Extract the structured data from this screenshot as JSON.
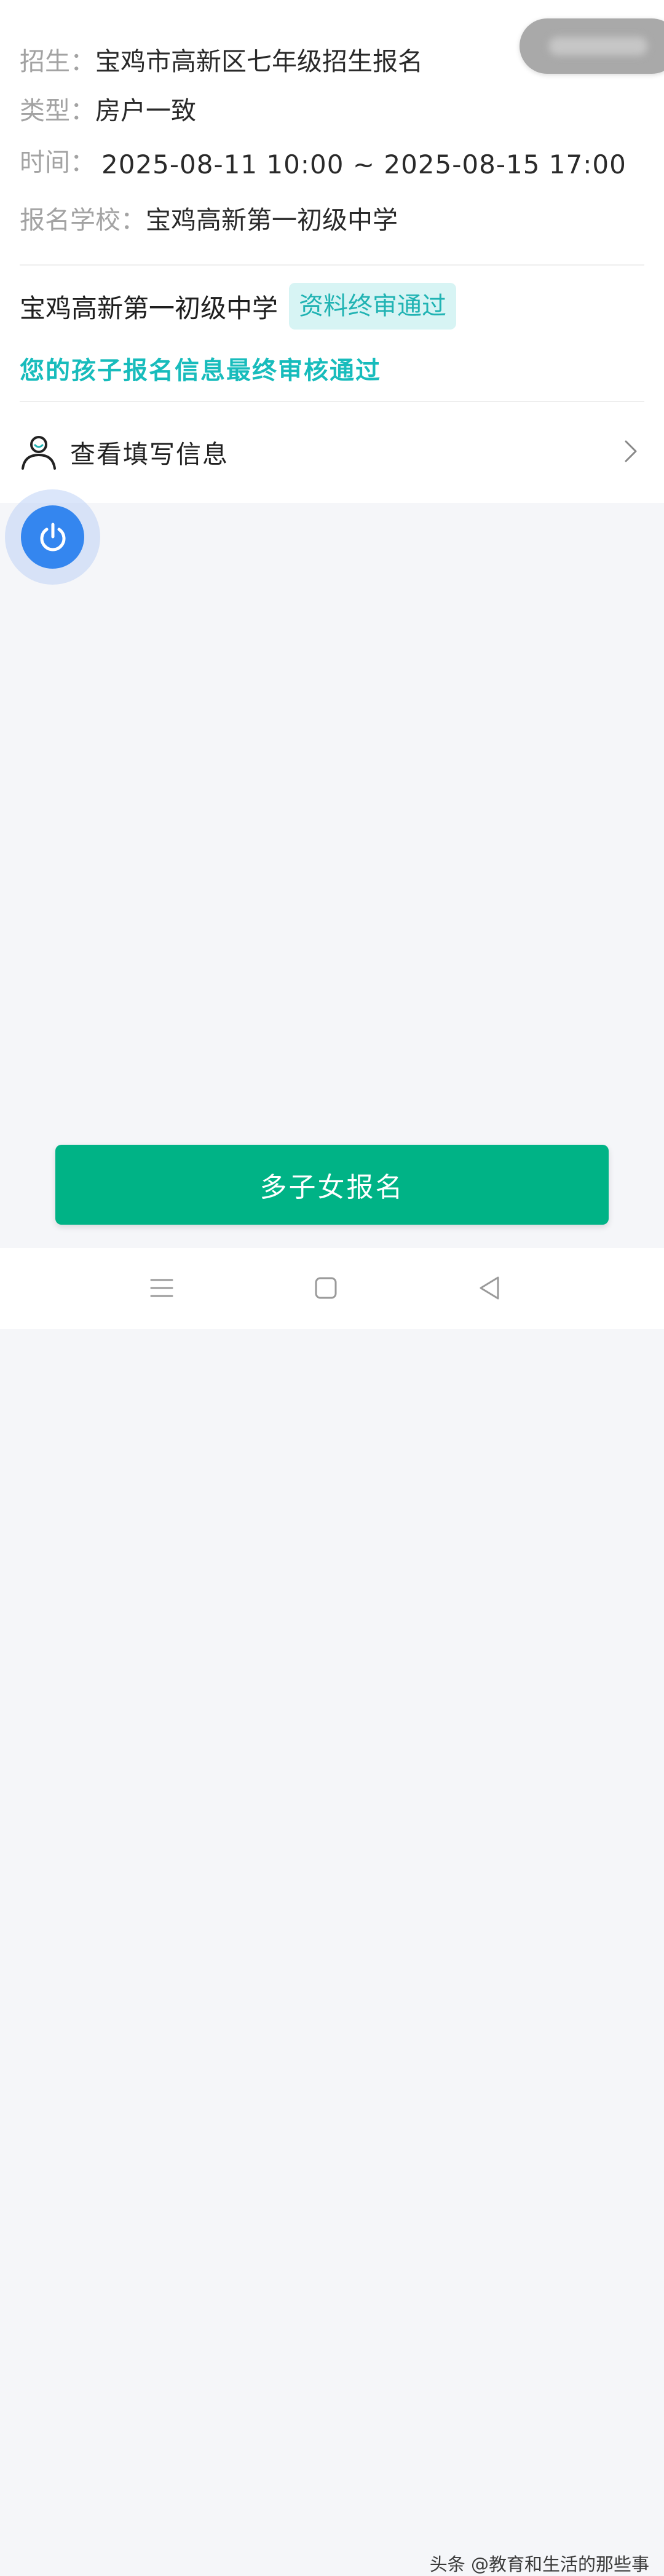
{
  "info": {
    "enroll_label": "招生：",
    "enroll_value": "宝鸡市高新区七年级招生报名",
    "type_label": "类型：",
    "type_value": "房户一致",
    "time_label": "时间：",
    "time_value": "2025-08-11 10:00 ~ 2025-08-15 17:00",
    "school_label": "报名学校：",
    "school_value": "宝鸡高新第一初级中学"
  },
  "status": {
    "school_name": "宝鸡高新第一初级中学",
    "badge": "资料终审通过",
    "badge_color": "#20b3b3",
    "notice": "您的孩子报名信息最终审核通过"
  },
  "view_info": {
    "label": "查看填写信息",
    "icon": "person-icon",
    "chevron": "chevron-right-icon"
  },
  "floating_button": {
    "icon": "power-icon",
    "color": "#3486ef"
  },
  "main_button": {
    "label": "多子女报名",
    "color": "#00b386"
  },
  "navbar": {
    "menu_icon": "menu-icon",
    "home_icon": "home-icon",
    "back_icon": "back-icon"
  },
  "watermark": {
    "text": "头条 @教育和生活的那些事"
  }
}
